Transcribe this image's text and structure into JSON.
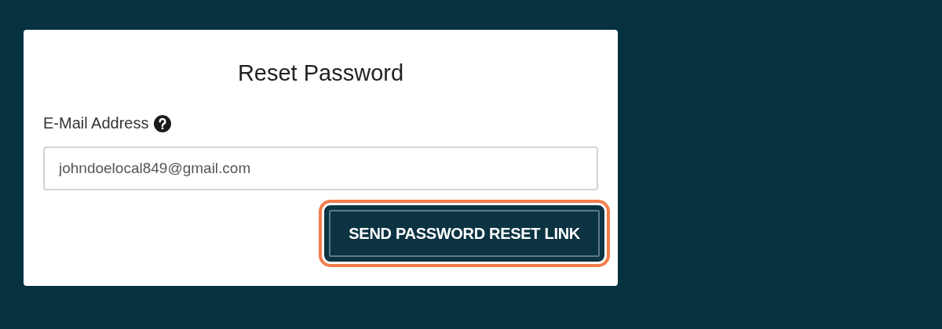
{
  "card": {
    "title": "Reset Password",
    "email_field": {
      "label": "E-Mail Address",
      "value": "johndoelocal849@gmail.com"
    },
    "submit_button": {
      "label": "SEND PASSWORD RESET LINK",
      "focused": true
    }
  }
}
